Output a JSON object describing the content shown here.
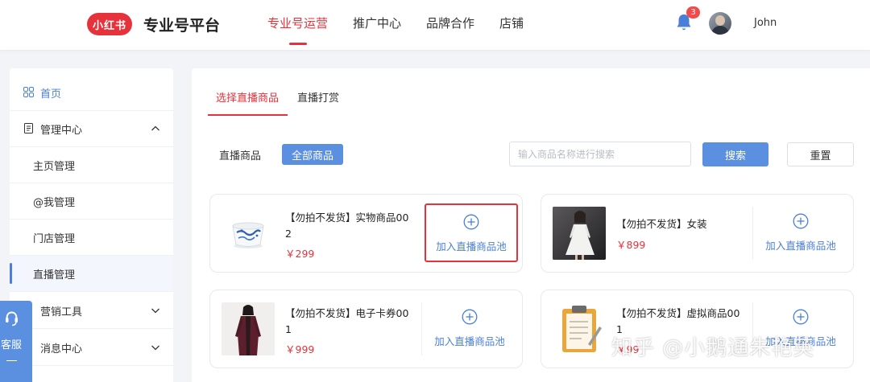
{
  "header": {
    "logo_text": "小红书",
    "platform_name": "专业号平台",
    "nav": [
      "专业号运营",
      "推广中心",
      "品牌合作",
      "店铺"
    ],
    "notification_count": "3",
    "username": "John"
  },
  "sidebar": {
    "items": [
      {
        "label": "首页"
      },
      {
        "label": "管理中心"
      },
      {
        "label": "主页管理"
      },
      {
        "label": "@我管理"
      },
      {
        "label": "门店管理"
      },
      {
        "label": "直播管理"
      },
      {
        "label": "营销工具"
      },
      {
        "label": "消息中心"
      }
    ],
    "service_label": "客服"
  },
  "main": {
    "tabs": [
      "选择直播商品",
      "直播打赏"
    ],
    "filter_label": "直播商品",
    "filter_chip": "全部商品",
    "search_placeholder": "输入商品名称进行搜索",
    "search_button": "搜索",
    "reset_button": "重置",
    "products": [
      {
        "name": "【勿拍不发货】实物商品002",
        "price": "￥299",
        "action": "加入直播商品池"
      },
      {
        "name": "【勿拍不发货】女装",
        "price": "￥899",
        "action": "加入直播商品池"
      },
      {
        "name": "【勿拍不发货】电子卡券001",
        "price": "￥999",
        "action": "加入直播商品池"
      },
      {
        "name": "【勿拍不发货】虚拟商品001",
        "price": "￥99",
        "action": "加入直播商品池"
      }
    ]
  },
  "watermark": "知乎 @小鹅通朱艳英",
  "colors": {
    "brand_red": "#e6323a",
    "accent_blue": "#5b8fe0",
    "link_blue": "#4a7fd8"
  }
}
